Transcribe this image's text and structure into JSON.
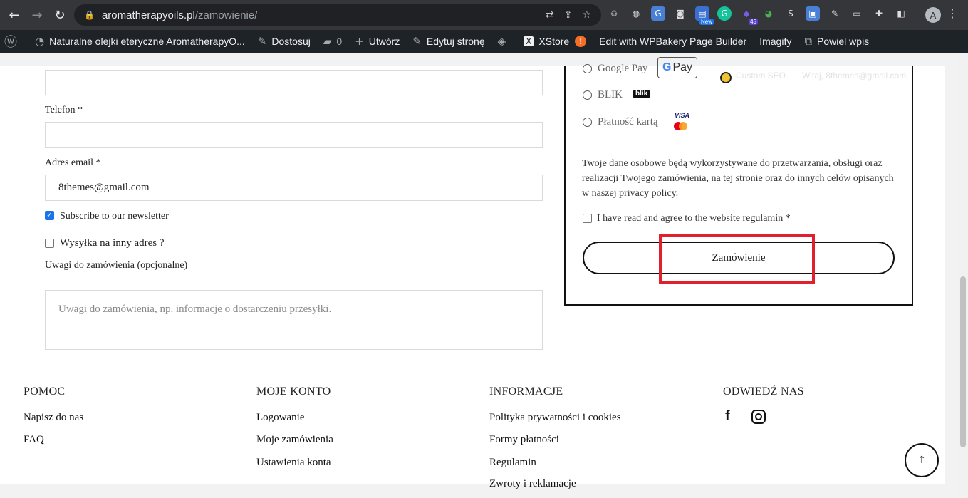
{
  "browser": {
    "url_domain": "aromatherapyoils.pl",
    "url_path": "/zamowienie/",
    "avatar_letter": "A",
    "ext_badge_count": "45",
    "ext_badge_new": "New"
  },
  "wp_admin": {
    "site_name": "Naturalne olejki eteryczne AromatherapyO...",
    "customize": "Dostosuj",
    "comments_count": "0",
    "new": "Utwórz",
    "edit_page": "Edytuj stronę",
    "xstore": "XStore",
    "xstore_alert": "!",
    "wpbakery": "Edit with WPBakery Page Builder",
    "imagify": "Imagify",
    "duplicate": "Powiel wpis"
  },
  "form": {
    "phone_label": "Telefon *",
    "phone_value": "",
    "email_label": "Adres email *",
    "email_value": "8themes@gmail.com",
    "newsletter_label": "Subscribe to our newsletter",
    "newsletter_checked": true,
    "ship_other_label": "Wysyłka na inny adres ?",
    "notes_label": "Uwagi do zamówienia (opcjonalne)",
    "notes_placeholder": "Uwagi do zamówienia, np. informacje o dostarczeniu przesyłki."
  },
  "order": {
    "payment_methods": [
      {
        "label": "Google Pay"
      },
      {
        "label": "BLIK"
      },
      {
        "label": "Płatność kartą"
      }
    ],
    "gpay_text": "Pay",
    "blik_logo": "blik",
    "visa_logo": "VISA",
    "faint_text_1": "Custom SEO",
    "faint_text_2": "Witaj, 8themes@gmail.com",
    "privacy_text": "Twoje dane osobowe będą wykorzystywane do przetwarzania, obsługi oraz realizacji Twojego zamówienia, na tej stronie oraz do innych celów opisanych w naszej privacy policy.",
    "agree_text": "I have read and agree to the website regulamin *",
    "submit_label": "Zamówienie"
  },
  "footer": {
    "columns": [
      {
        "title": "POMOC",
        "links": [
          "Napisz do nas",
          "FAQ"
        ]
      },
      {
        "title": "MOJE KONTO",
        "links": [
          "Logowanie",
          "Moje zamówienia",
          "Ustawienia konta"
        ]
      },
      {
        "title": "INFORMACJE",
        "links": [
          "Polityka prywatności i cookies",
          "Formy płatności",
          "Regulamin",
          "Zwroty i reklamacje"
        ]
      },
      {
        "title": "ODWIEDŹ NAS",
        "links": []
      }
    ],
    "social_icons": [
      "facebook-icon",
      "instagram-icon"
    ]
  },
  "colors": {
    "accent_green": "#38a85a",
    "highlight_red": "#e0202a"
  }
}
